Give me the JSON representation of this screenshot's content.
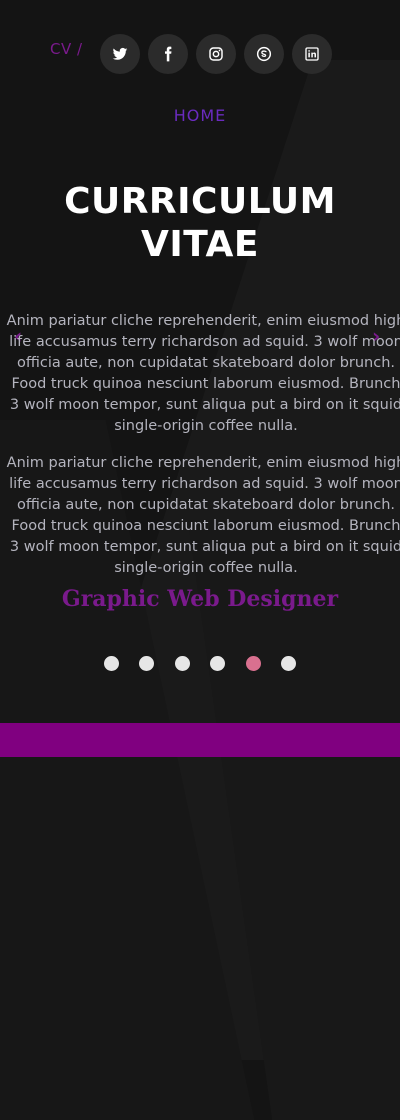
{
  "header": {
    "breadcrumb": "CV /",
    "social": [
      {
        "icon": "twitter-icon"
      },
      {
        "icon": "facebook-icon"
      },
      {
        "icon": "instagram-icon"
      },
      {
        "icon": "skype-icon"
      },
      {
        "icon": "linkedin-icon"
      }
    ]
  },
  "nav": {
    "home_label": "HOME"
  },
  "hero": {
    "title": "CURRICULUM VITAE",
    "paragraphs": [
      "Anim pariatur cliche reprehenderit, enim eiusmod high life accusamus terry richardson ad squid. 3 wolf moon officia aute, non cupidatat skateboard dolor brunch. Food truck quinoa nesciunt laborum eiusmod. Brunch 3 wolf moon tempor, sunt aliqua put a bird on it squid single-origin coffee nulla.",
      "Anim pariatur cliche reprehenderit, enim eiusmod high life accusamus terry richardson ad squid. 3 wolf moon officia aute, non cupidatat skateboard dolor brunch. Food truck quinoa nesciunt laborum eiusmod. Brunch 3 wolf moon tempor, sunt aliqua put a bird on it squid single-origin coffee nulla."
    ],
    "subtitle": "Graphic Web Designer",
    "prev_arrow": "‹",
    "next_arrow": "›"
  },
  "carousel": {
    "count": 6,
    "active_index": 4
  },
  "colors": {
    "background": "#141414",
    "accent_purple": "#800080",
    "nav_blue": "#6a2bbf",
    "active_dot": "#d9708f",
    "dot": "#e6e6e6"
  }
}
